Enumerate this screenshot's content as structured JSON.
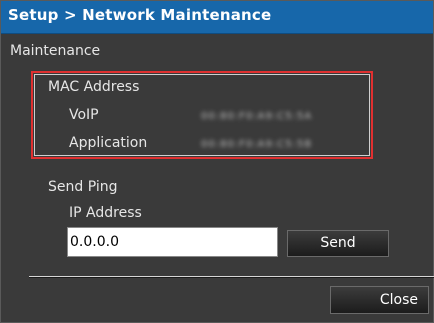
{
  "window": {
    "title": "Setup > Network Maintenance"
  },
  "maintenance": {
    "label": "Maintenance",
    "mac_address": {
      "title": "MAC Address",
      "rows": [
        {
          "label": "VoIP",
          "value": "00:80:F0:A9:C5:5A"
        },
        {
          "label": "Application",
          "value": "00:80:F0:A9:C5:5B"
        }
      ]
    },
    "send_ping": {
      "title": "Send Ping",
      "ip_label": "IP Address",
      "ip_value": "0.0.0.0",
      "send_label": "Send"
    }
  },
  "footer": {
    "close_label": "Close"
  },
  "colors": {
    "titlebar": "#1767aa",
    "highlight_border": "#e03030",
    "background": "#3a3a3a"
  }
}
